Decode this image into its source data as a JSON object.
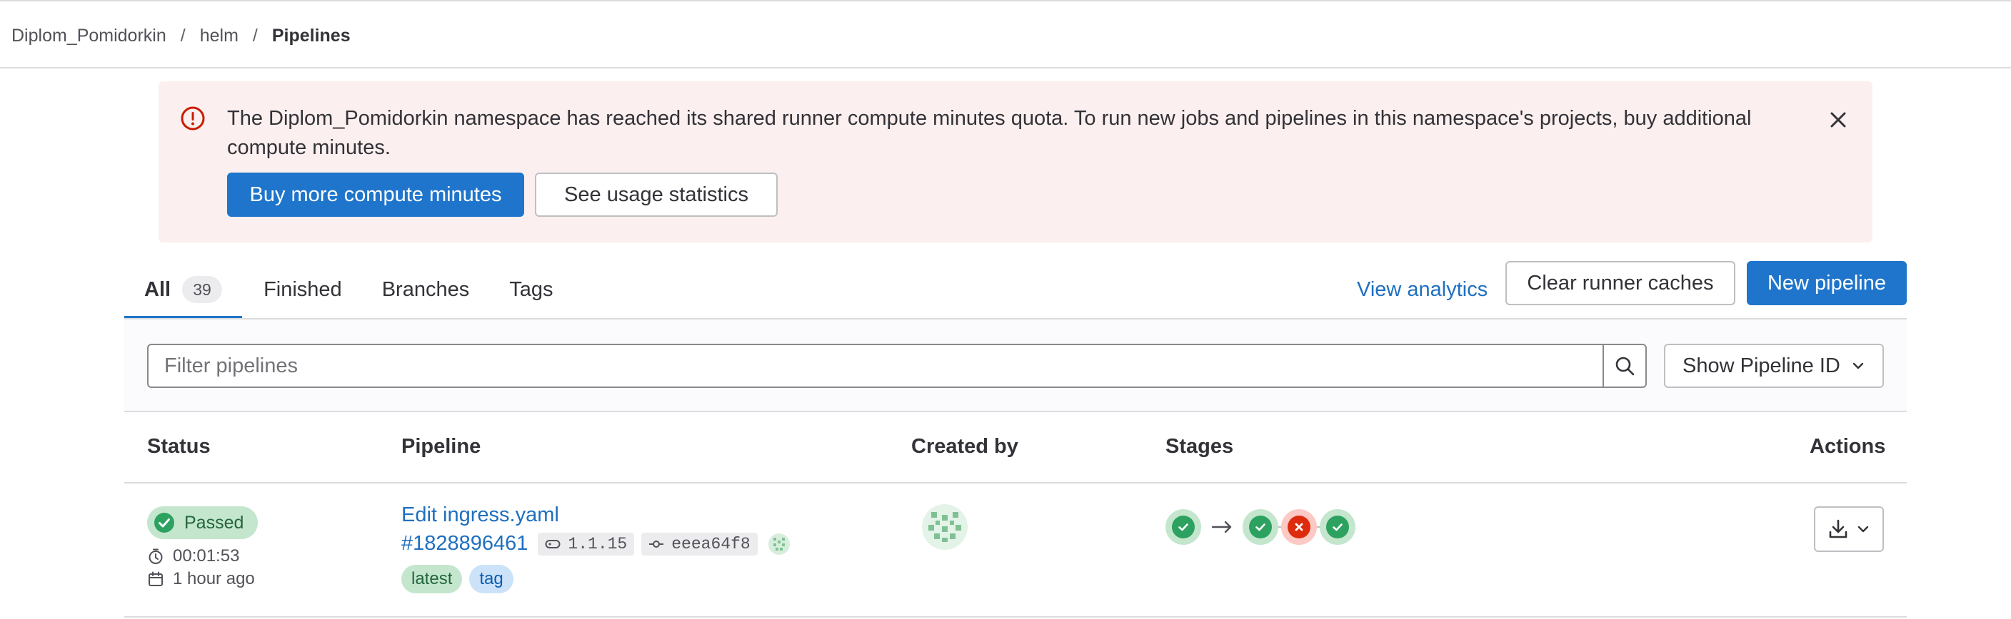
{
  "breadcrumb": {
    "items": [
      "Diplom_Pomidorkin",
      "helm"
    ],
    "current": "Pipelines",
    "separator": "/"
  },
  "alert": {
    "message": "The Diplom_Pomidorkin namespace has reached its shared runner compute minutes quota. To run new jobs and pipelines in this namespace's projects, buy additional compute minutes.",
    "buy_label": "Buy more compute minutes",
    "usage_label": "See usage statistics"
  },
  "tabs": [
    {
      "label": "All",
      "count": "39"
    },
    {
      "label": "Finished"
    },
    {
      "label": "Branches"
    },
    {
      "label": "Tags"
    }
  ],
  "actions": {
    "analytics_label": "View analytics",
    "clear_cache_label": "Clear runner caches",
    "new_pipeline_label": "New pipeline"
  },
  "filter": {
    "placeholder": "Filter pipelines",
    "dropdown_label": "Show Pipeline ID"
  },
  "table": {
    "headers": {
      "status": "Status",
      "pipeline": "Pipeline",
      "created_by": "Created by",
      "stages": "Stages",
      "actions": "Actions"
    },
    "rows": [
      {
        "status": "Passed",
        "duration": "00:01:53",
        "finished": "1 hour ago",
        "title": "Edit ingress.yaml",
        "id": "#1828896461",
        "ref": "1.1.15",
        "commit": "eeea64f8",
        "labels": [
          "latest",
          "tag"
        ],
        "stages": [
          "success",
          "success",
          "failed",
          "success"
        ]
      }
    ]
  },
  "colors": {
    "primary": "#1f75cb",
    "link": "#1f6fbf",
    "alert_bg": "#fbf0ef",
    "alert_icon": "#c91c00",
    "success": "#2da160",
    "failed": "#dd2b0e"
  }
}
